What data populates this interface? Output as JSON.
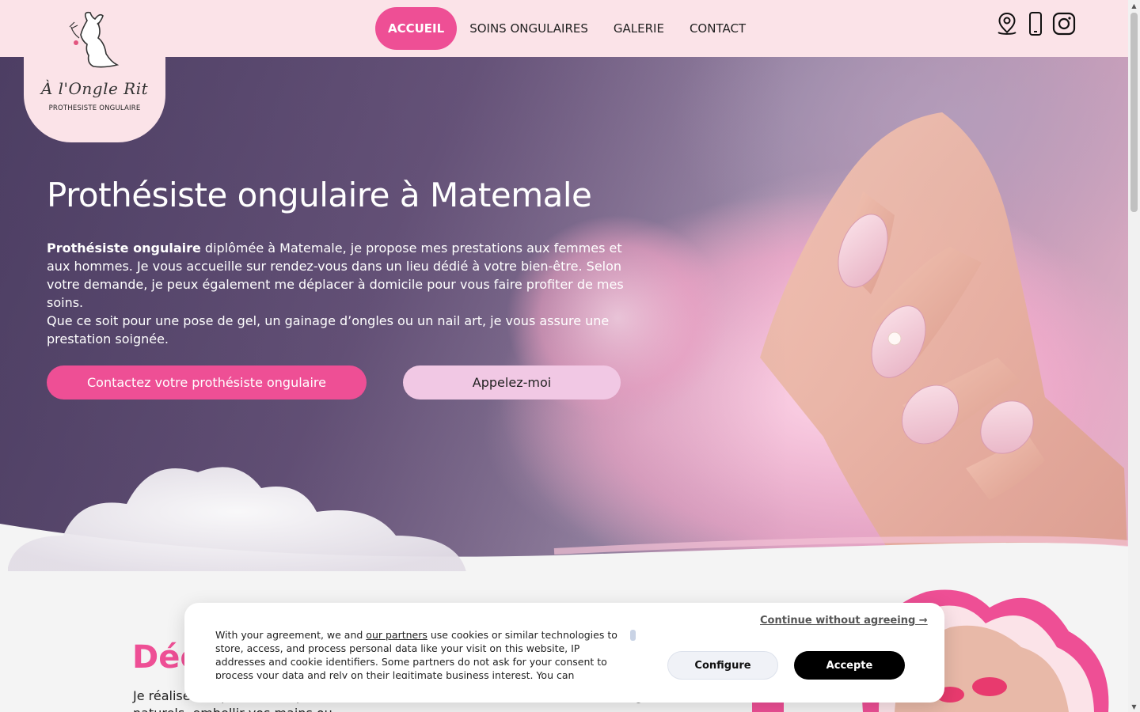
{
  "header": {
    "logo_name": "À l'Ongle Rit",
    "logo_subtitle": "PROTHESISTE ONGULAIRE",
    "nav": [
      {
        "label": "ACCUEIL",
        "active": true
      },
      {
        "label": "SOINS ONGULAIRES",
        "active": false
      },
      {
        "label": "GALERIE",
        "active": false
      },
      {
        "label": "CONTACT",
        "active": false
      }
    ],
    "icons": [
      "location-icon",
      "phone-icon",
      "instagram-icon"
    ]
  },
  "hero": {
    "title": "Prothésiste ongulaire à Matemale",
    "text_bold": "Prothésiste ongulaire",
    "text_rest": " diplômée à Matemale, je propose mes prestations aux femmes et aux hommes. Je vous accueille sur rendez-vous dans un lieu dédié à votre bien-être. Selon votre demande, je peux également me déplacer à domicile pour vous faire profiter de mes soins.",
    "text_second": "Que ce soit pour une pose de gel, un gainage d’ongles ou un nail art, je vous assure une prestation soignée.",
    "btn_contact": "Contactez votre prothésiste ongulaire",
    "btn_call": "Appelez-moi"
  },
  "section": {
    "title": "Déc",
    "text": "Je réalise des prestations personnalisées. Que vous souhaitiez renforcer vos ongles naturels, embellir vos mains ou"
  },
  "cookie": {
    "text_before": "With your agreement, we and ",
    "link": "our partners",
    "text_after": " use cookies or similar technologies to store, access, and process personal data like your visit on this website, IP addresses and cookie identifiers. Some partners do not ask for your consent to process your data and rely on their legitimate business interest. You can",
    "continue": "Continue without agreeing →",
    "configure": "Configure",
    "accept": "Accepte"
  },
  "colors": {
    "accent": "#ee4f95",
    "header_bg": "#fbe3e8",
    "light_button": "#f1c8e4"
  }
}
